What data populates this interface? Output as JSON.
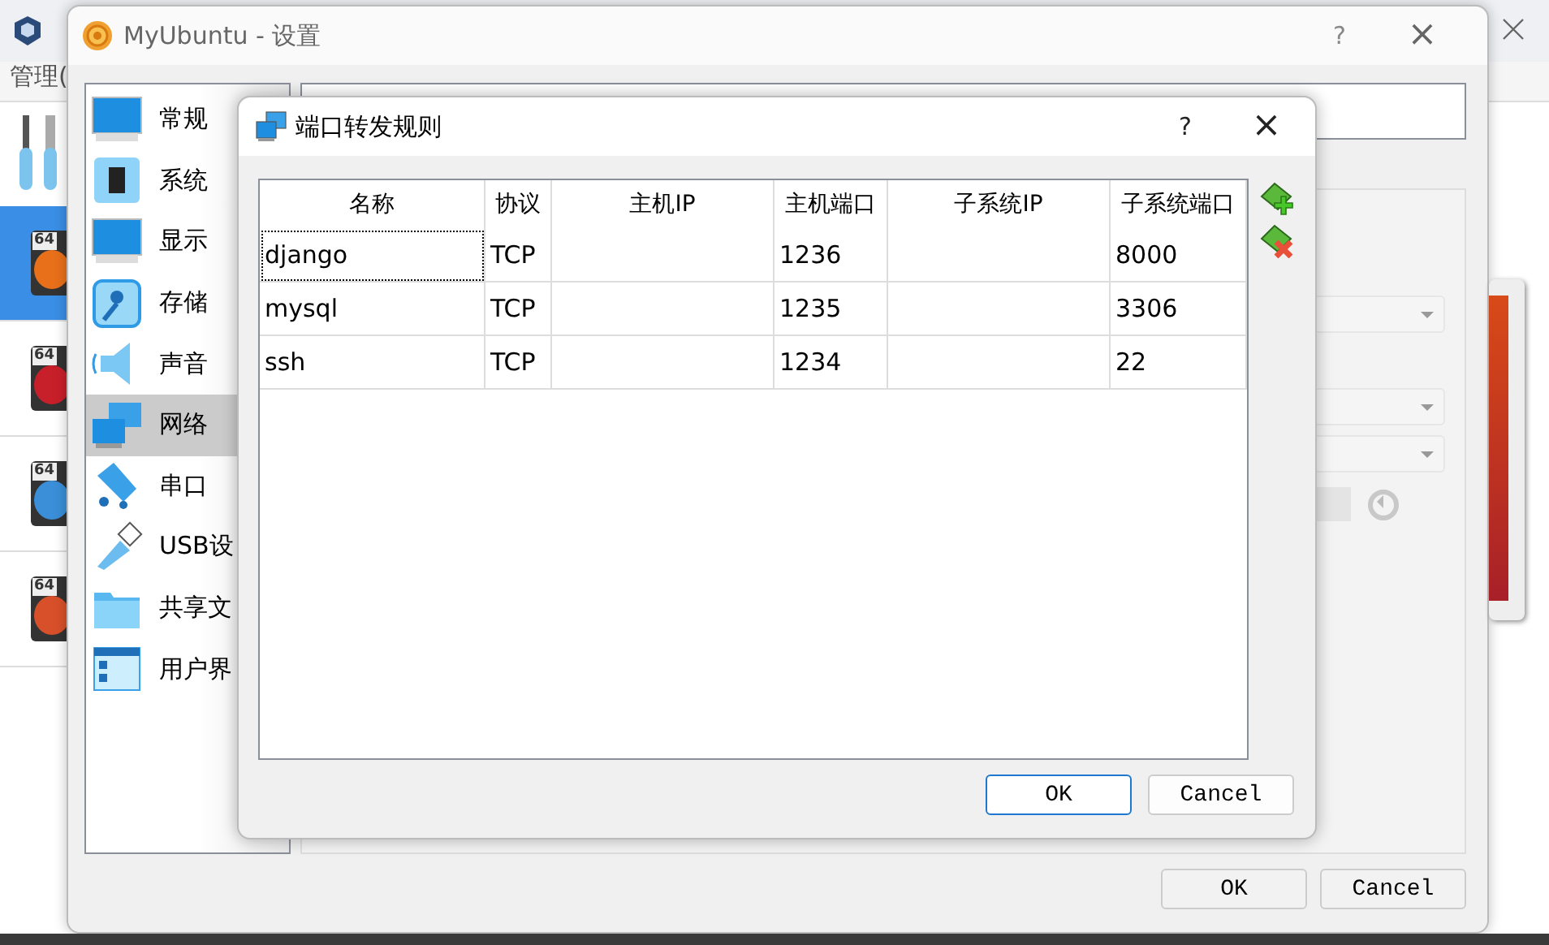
{
  "manager_window": {
    "menu": "管理(",
    "vms": [
      {
        "badge": "64",
        "selected": true,
        "color": "#e8701a"
      },
      {
        "badge": "64",
        "selected": false,
        "color": "#c8202a"
      },
      {
        "badge": "64",
        "selected": false,
        "color": "#3a8fd8"
      },
      {
        "badge": "64",
        "selected": false,
        "color": "#d8502a"
      }
    ]
  },
  "settings_window": {
    "title": "MyUbuntu - 设置",
    "help": "?",
    "close": "×",
    "sidebar": [
      {
        "label": "常规",
        "selected": false
      },
      {
        "label": "系统",
        "selected": false
      },
      {
        "label": "显示",
        "selected": false
      },
      {
        "label": "存储",
        "selected": false
      },
      {
        "label": "声音",
        "selected": false
      },
      {
        "label": "网络",
        "selected": true
      },
      {
        "label": "串口",
        "selected": false
      },
      {
        "label": "USB设",
        "selected": false
      },
      {
        "label": "共享文",
        "selected": false
      },
      {
        "label": "用户界",
        "selected": false
      }
    ],
    "buttons": [
      {
        "label": "OK",
        "focused": false
      },
      {
        "label": "Cancel",
        "focused": false
      }
    ]
  },
  "dialog": {
    "title": "端口转发规则",
    "help": "?",
    "close": "×",
    "table": {
      "columns": [
        "名称",
        "协议",
        "主机IP",
        "主机端口",
        "子系统IP",
        "子系统端口"
      ],
      "rows": [
        {
          "cells": [
            "django",
            "TCP",
            "",
            "1236",
            "",
            "8000"
          ],
          "focused": true
        },
        {
          "cells": [
            "mysql",
            "TCP",
            "",
            "1235",
            "",
            "3306"
          ],
          "focused": false
        },
        {
          "cells": [
            "ssh",
            "TCP",
            "",
            "1234",
            "",
            "22"
          ],
          "focused": false
        }
      ]
    },
    "buttons": [
      {
        "label": "OK",
        "focused": true
      },
      {
        "label": "Cancel",
        "focused": false
      }
    ]
  }
}
